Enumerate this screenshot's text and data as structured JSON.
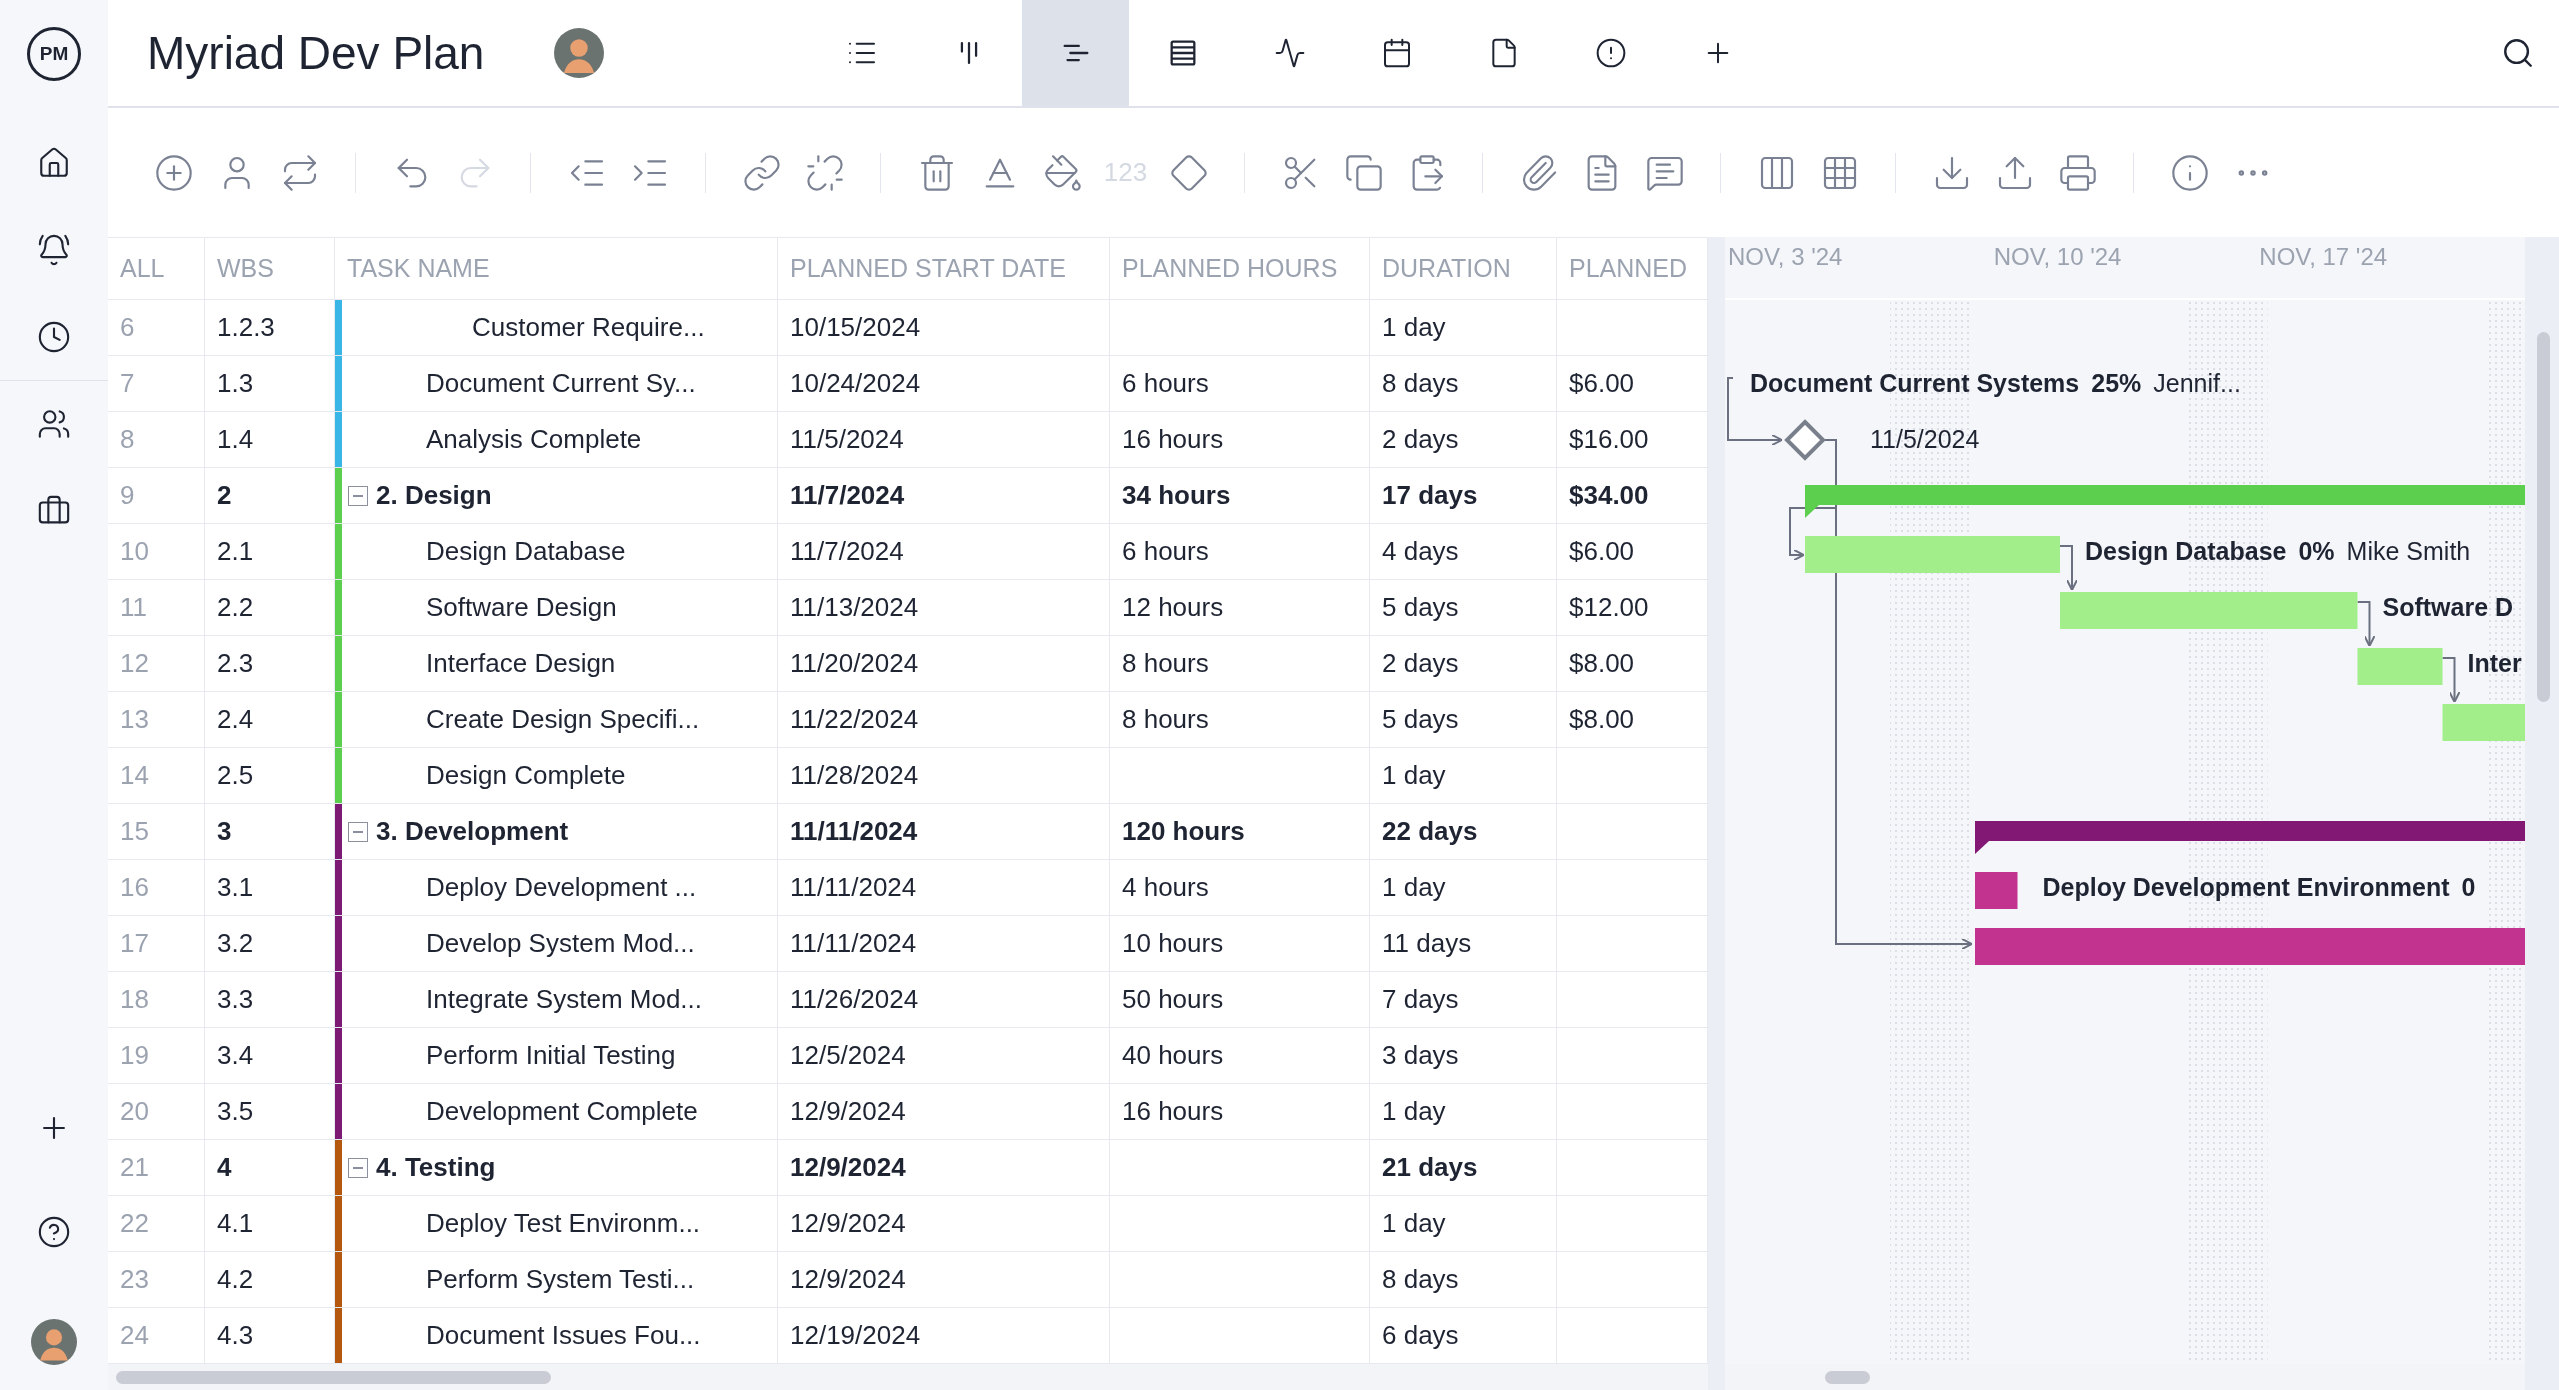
{
  "sidebar": {
    "logo": "PM",
    "top_items": [
      {
        "kind": "home"
      },
      {
        "kind": "notifications"
      },
      {
        "kind": "time"
      },
      {
        "kind": "people"
      },
      {
        "kind": "portfolio"
      }
    ],
    "bottom_items": [
      {
        "kind": "add"
      },
      {
        "kind": "help"
      },
      {
        "kind": "avatar"
      }
    ]
  },
  "header": {
    "title": "Myriad Dev Plan",
    "views": [
      {
        "kind": "list",
        "selected": false
      },
      {
        "kind": "board",
        "selected": false
      },
      {
        "kind": "gantt",
        "selected": true
      },
      {
        "kind": "sheet",
        "selected": false
      },
      {
        "kind": "dashboard",
        "selected": false
      },
      {
        "kind": "calendar",
        "selected": false
      },
      {
        "kind": "file",
        "selected": false
      },
      {
        "kind": "alert",
        "selected": false
      },
      {
        "kind": "add",
        "selected": false
      }
    ]
  },
  "toolbar": [
    [
      {
        "kind": "add"
      },
      {
        "kind": "assign"
      },
      {
        "kind": "swap"
      }
    ],
    [
      {
        "kind": "undo",
        "disabled": false
      },
      {
        "kind": "redo",
        "disabled": true
      }
    ],
    [
      {
        "kind": "outdent"
      },
      {
        "kind": "indent"
      }
    ],
    [
      {
        "kind": "link"
      },
      {
        "kind": "unlink"
      }
    ],
    [
      {
        "kind": "delete"
      },
      {
        "kind": "text-color"
      },
      {
        "kind": "fill-color"
      },
      {
        "kind": "number",
        "label": "123",
        "disabled": true
      },
      {
        "kind": "milestone"
      }
    ],
    [
      {
        "kind": "cut"
      },
      {
        "kind": "copy"
      },
      {
        "kind": "paste"
      }
    ],
    [
      {
        "kind": "attach"
      },
      {
        "kind": "notes"
      },
      {
        "kind": "comment"
      }
    ],
    [
      {
        "kind": "columns"
      },
      {
        "kind": "grid"
      }
    ],
    [
      {
        "kind": "import"
      },
      {
        "kind": "export"
      },
      {
        "kind": "print"
      }
    ],
    [
      {
        "kind": "info"
      },
      {
        "kind": "more"
      }
    ]
  ],
  "table": {
    "columns": [
      "ALL",
      "WBS",
      "TASK NAME",
      "PLANNED START DATE",
      "PLANNED HOURS",
      "DURATION",
      "PLANNED"
    ],
    "rows": [
      {
        "kind": "task",
        "num": "6",
        "wbs": "1.2.3",
        "name": "Customer Require...",
        "start": "10/15/2024",
        "duration": "1 day",
        "color": "#3ab6e6"
      },
      {
        "kind": "task",
        "num": "7",
        "wbs": "1.3",
        "name": "Document Current Sy...",
        "start": "10/24/2024",
        "hours": "6 hours",
        "duration": "8 days",
        "cost": "$6.00",
        "color": "#3ab6e6",
        "bar": {
          "kind": "offscreen",
          "label": "Document Current Systems",
          "percent": "25%",
          "assignee": "Jennif..."
        }
      },
      {
        "kind": "task",
        "num": "8",
        "wbs": "1.4",
        "name": "Analysis Complete",
        "start": "11/5/2024",
        "hours": "16 hours",
        "duration": "2 days",
        "cost": "$16.00",
        "color": "#3ab6e6",
        "bar": {
          "kind": "milestone",
          "label": "11/5/2024"
        }
      },
      {
        "kind": "summary",
        "expanded": true,
        "num": "9",
        "wbs": "2",
        "name": "2. Design",
        "start": "11/7/2024",
        "hours": "34 hours",
        "duration": "17 days",
        "cost": "$34.00",
        "color": "#5ccf4e",
        "bar": {
          "kind": "summary",
          "color": "#5ccf4e"
        },
        "children": [
          {
            "kind": "task",
            "num": "10",
            "wbs": "2.1",
            "name": "Design Database",
            "start": "11/7/2024",
            "hours": "6 hours",
            "duration": "4 days",
            "cost": "$6.00",
            "color": "#5ccf4e",
            "bar": {
              "kind": "task",
              "color": "#a1ee8a",
              "label": "Design Database",
              "percent": "0%",
              "assignee": "Mike Smith"
            }
          },
          {
            "kind": "task",
            "num": "11",
            "wbs": "2.2",
            "name": "Software Design",
            "start": "11/13/2024",
            "hours": "12 hours",
            "duration": "5 days",
            "cost": "$12.00",
            "color": "#5ccf4e",
            "bar": {
              "kind": "task",
              "color": "#a1ee8a",
              "label": "Software D"
            }
          },
          {
            "kind": "task",
            "num": "12",
            "wbs": "2.3",
            "name": "Interface Design",
            "start": "11/20/2024",
            "hours": "8 hours",
            "duration": "2 days",
            "cost": "$8.00",
            "color": "#5ccf4e",
            "bar": {
              "kind": "task",
              "color": "#a1ee8a",
              "label": "Inter"
            }
          },
          {
            "kind": "task",
            "num": "13",
            "wbs": "2.4",
            "name": "Create Design Specifi...",
            "start": "11/22/2024",
            "hours": "8 hours",
            "duration": "5 days",
            "cost": "$8.00",
            "color": "#5ccf4e",
            "bar": {
              "kind": "task",
              "color": "#a1ee8a"
            }
          },
          {
            "kind": "task",
            "num": "14",
            "wbs": "2.5",
            "name": "Design Complete",
            "start": "11/28/2024",
            "duration": "1 day",
            "color": "#5ccf4e"
          }
        ]
      },
      {
        "kind": "summary",
        "expanded": true,
        "num": "15",
        "wbs": "3",
        "name": "3. Development",
        "start": "11/11/2024",
        "hours": "120 hours",
        "duration": "22 days",
        "color": "#7d1a73",
        "bar": {
          "kind": "summary",
          "color": "#821873"
        },
        "children": [
          {
            "kind": "task",
            "num": "16",
            "wbs": "3.1",
            "name": "Deploy Development ...",
            "start": "11/11/2024",
            "hours": "4 hours",
            "duration": "1 day",
            "color": "#7d1a73",
            "bar": {
              "kind": "task",
              "color": "#c2338f",
              "label": "Deploy Development Environment",
              "percent": "0"
            }
          },
          {
            "kind": "task",
            "num": "17",
            "wbs": "3.2",
            "name": "Develop System Mod...",
            "start": "11/11/2024",
            "hours": "10 hours",
            "duration": "11 days",
            "color": "#7d1a73",
            "bar": {
              "kind": "task",
              "color": "#c2338f"
            }
          },
          {
            "kind": "task",
            "num": "18",
            "wbs": "3.3",
            "name": "Integrate System Mod...",
            "start": "11/26/2024",
            "hours": "50 hours",
            "duration": "7 days",
            "color": "#7d1a73"
          },
          {
            "kind": "task",
            "num": "19",
            "wbs": "3.4",
            "name": "Perform Initial Testing",
            "start": "12/5/2024",
            "hours": "40 hours",
            "duration": "3 days",
            "color": "#7d1a73"
          },
          {
            "kind": "task",
            "num": "20",
            "wbs": "3.5",
            "name": "Development Complete",
            "start": "12/9/2024",
            "hours": "16 hours",
            "duration": "1 day",
            "color": "#7d1a73"
          }
        ]
      },
      {
        "kind": "summary",
        "expanded": true,
        "num": "21",
        "wbs": "4",
        "name": "4. Testing",
        "start": "12/9/2024",
        "duration": "21 days",
        "color": "#b4570f",
        "children": [
          {
            "kind": "task",
            "num": "22",
            "wbs": "4.1",
            "name": "Deploy Test Environm...",
            "start": "12/9/2024",
            "duration": "1 day",
            "color": "#b4570f"
          },
          {
            "kind": "task",
            "num": "23",
            "wbs": "4.2",
            "name": "Perform System Testi...",
            "start": "12/9/2024",
            "duration": "8 days",
            "color": "#b4570f"
          },
          {
            "kind": "task",
            "num": "24",
            "wbs": "4.3",
            "name": "Document Issues Fou...",
            "start": "12/19/2024",
            "duration": "6 days",
            "color": "#b4570f"
          }
        ]
      }
    ]
  },
  "gantt": {
    "weeks": [
      "NOV, 3 '24",
      "NOV, 10 '24",
      "NOV, 17 '24"
    ]
  }
}
